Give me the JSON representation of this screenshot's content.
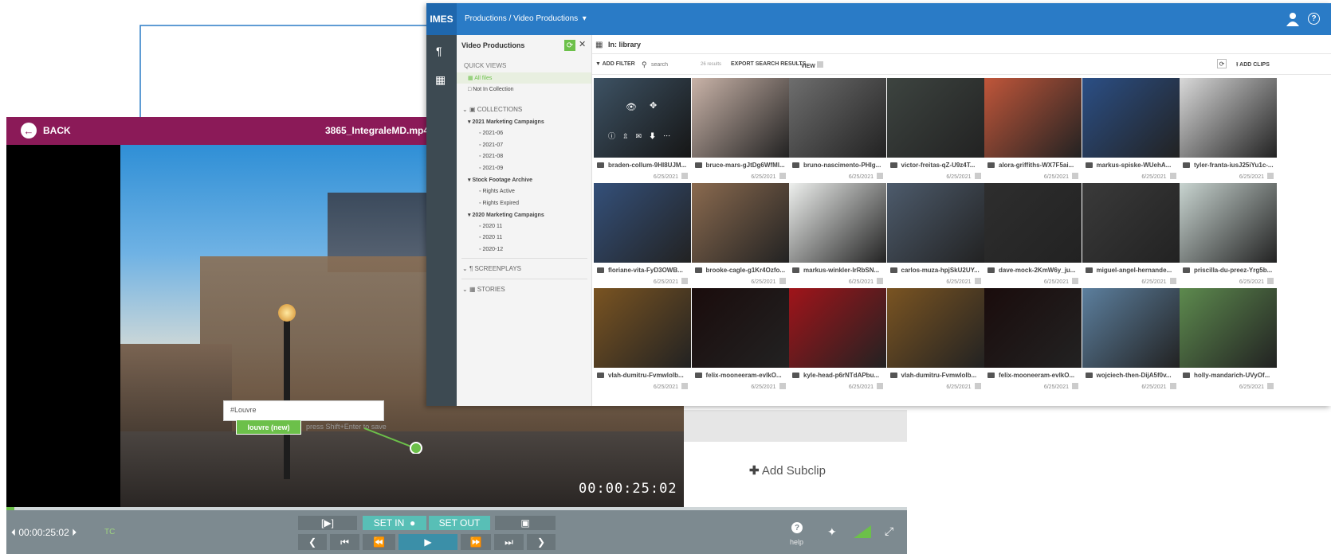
{
  "player": {
    "back_label": "BACK",
    "file_name": "3865_IntegraleMD.mp4",
    "timecode_overlay": "00:00:25:02",
    "tag_input_value": "#Louvre",
    "tag_suggestion": "louvre (new)",
    "tag_hint": "press Shift+Enter to save",
    "add_subclip_label": "Add Subclip",
    "timecode_display": "00:00:25:02",
    "timecode_label": "TC",
    "set_in_label": "SET IN",
    "set_out_label": "SET OUT",
    "help_label": "help"
  },
  "library": {
    "logo": "IMES",
    "breadcrumb": "Productions / Video Productions",
    "panel_title": "Video Productions",
    "location": "In: library",
    "quick_views_title": "QUICK VIEWS",
    "quick_views": [
      "All files",
      "Not In Collection"
    ],
    "collections_title": "COLLECTIONS",
    "groups": [
      {
        "name": "2021 Marketing Campaigns",
        "items": [
          "2021-06",
          "2021-07",
          "2021-08",
          "2021-09"
        ]
      },
      {
        "name": "Stock Footage Archive",
        "items": [
          "Rights Active",
          "Rights Expired"
        ]
      },
      {
        "name": "2020 Marketing Campaigns",
        "items": [
          "2020 11",
          "2020 11",
          "2020-12"
        ]
      }
    ],
    "screenplays_title": "SCREENPLAYS",
    "stories_title": "STORIES",
    "toolbar": {
      "add_filter": "ADD FILTER",
      "search_placeholder": "search",
      "results_count": "26 results",
      "export": "EXPORT SEARCH RESULTS",
      "view": "VIEW",
      "add_clips": "ADD CLIPS"
    },
    "assets": [
      {
        "name": "braden-collum-9HI8UJM...",
        "date": "6/25/2021",
        "color": "#5f7f9a"
      },
      {
        "name": "bruce-mars-gJtDg6WfMl...",
        "date": "6/25/2021",
        "color": "#c9b3a8"
      },
      {
        "name": "bruno-nascimento-PHIg...",
        "date": "6/25/2021",
        "color": "#6e6e6e"
      },
      {
        "name": "victor-freitas-qZ-U9z4T...",
        "date": "6/25/2021",
        "color": "#3d4440"
      },
      {
        "name": "alora-griffiths-WX7F5ai...",
        "date": "6/25/2021",
        "color": "#c0563a"
      },
      {
        "name": "markus-spiske-WUehA...",
        "date": "6/25/2021",
        "color": "#2b4f86"
      },
      {
        "name": "tyler-franta-iusJ25iYu1c-...",
        "date": "6/25/2021",
        "color": "#d9d9d9"
      },
      {
        "name": "floriane-vita-FyD3OWB...",
        "date": "6/25/2021",
        "color": "#34507a"
      },
      {
        "name": "brooke-cagle-g1Kr4Ozfo...",
        "date": "6/25/2021",
        "color": "#8a6a4f"
      },
      {
        "name": "markus-winkler-IrRbSN...",
        "date": "6/25/2021",
        "color": "#eef0ee"
      },
      {
        "name": "carlos-muza-hpjSkU2UY...",
        "date": "6/25/2021",
        "color": "#4d5b6c"
      },
      {
        "name": "dave-mock-2KmW6y_ju...",
        "date": "6/25/2021",
        "color": "#2e2e2e"
      },
      {
        "name": "miguel-angel-hernande...",
        "date": "6/25/2021",
        "color": "#3a3a3a"
      },
      {
        "name": "priscilla-du-preez-Yrg5b...",
        "date": "6/25/2021",
        "color": "#c8d4d0"
      },
      {
        "name": "vlah-dumitru-Fvmwlolb...",
        "date": "6/25/2021",
        "color": "#7a5422"
      },
      {
        "name": "felix-mooneeram-evlkO...",
        "date": "6/25/2021",
        "color": "#1a0c0c"
      },
      {
        "name": "kyle-head-p6rNTdAPbu...",
        "date": "6/25/2021",
        "color": "#a0141a"
      },
      {
        "name": "vlah-dumitru-Fvmwlolb...",
        "date": "6/25/2021",
        "color": "#7a5422"
      },
      {
        "name": "felix-mooneeram-evlkO...",
        "date": "6/25/2021",
        "color": "#1a0c0c"
      },
      {
        "name": "wojciech-then-DijA5f0v...",
        "date": "6/25/2021",
        "color": "#5c7f9e"
      },
      {
        "name": "holly-mandarich-UVyOf...",
        "date": "6/25/2021",
        "color": "#5d8a4e"
      }
    ]
  }
}
